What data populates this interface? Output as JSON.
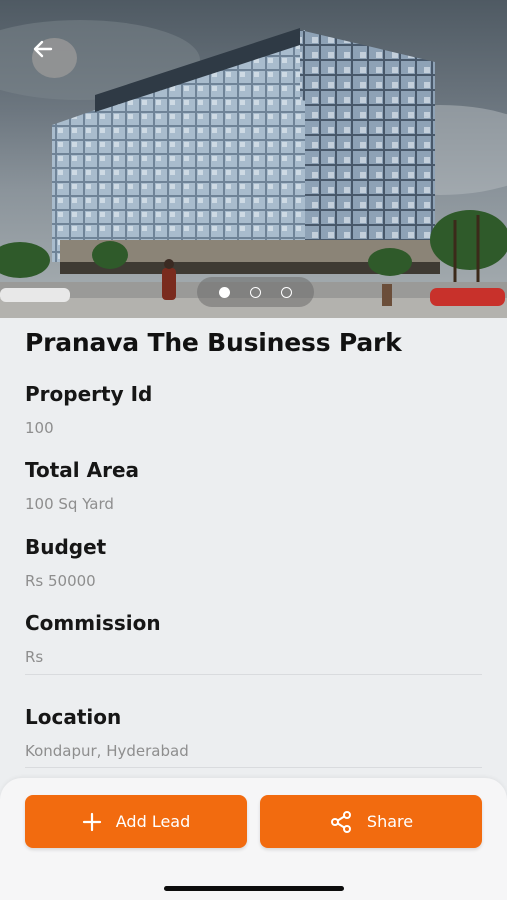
{
  "property": {
    "title": "Pranava The Business Park",
    "fields": [
      {
        "label": "Property Id",
        "value": "100"
      },
      {
        "label": "Total Area",
        "value": "100 Sq Yard"
      },
      {
        "label": "Budget",
        "value": "Rs 50000"
      },
      {
        "label": "Commission",
        "value": "Rs"
      },
      {
        "label": "Location",
        "value": "Kondapur, Hyderabad"
      }
    ]
  },
  "carousel": {
    "total": 3,
    "active": 1
  },
  "icons": {
    "back": "arrow-left-icon",
    "add": "plus-icon",
    "share": "share-icon"
  },
  "actions": {
    "add_lead_label": "Add Lead",
    "share_label": "Share"
  },
  "colors": {
    "accent": "#f26b0f",
    "background": "#eceef0",
    "value_text": "#8e8e8e"
  }
}
